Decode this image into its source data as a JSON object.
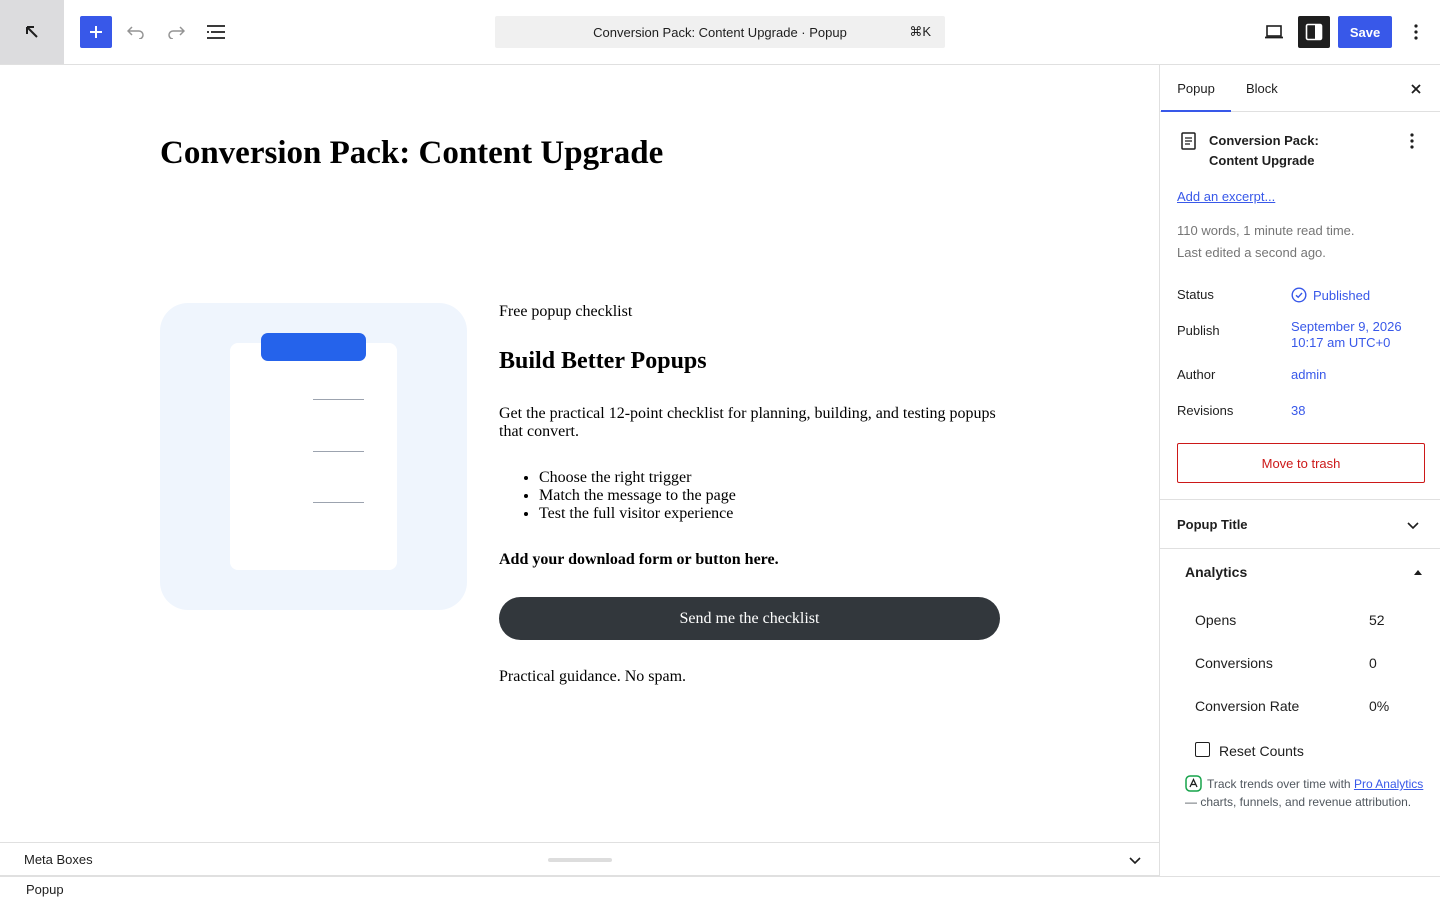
{
  "toolbar": {
    "command_title": "Conversion Pack: Content Upgrade · Popup",
    "command_shortcut": "⌘K",
    "save_label": "Save"
  },
  "icons": {
    "back": "arrow-up-left-icon",
    "add": "plus-icon",
    "undo": "undo-icon",
    "redo": "redo-icon",
    "outline": "list-view-icon",
    "preview": "laptop-icon",
    "sidebar": "sidebar-icon",
    "more": "vertical-ellipsis-icon"
  },
  "canvas": {
    "title": "Conversion Pack: Content Upgrade",
    "eyebrow": "Free popup checklist",
    "headline": "Build Better Popups",
    "description": "Get the practical 12-point checklist for planning, building, and testing popups that convert.",
    "bullets": [
      "Choose the right trigger",
      "Match the message to the page",
      "Test the full visitor experience"
    ],
    "form_note": "Add your download form or button here.",
    "cta_label": "Send me the checklist",
    "footnote": "Practical guidance. No spam."
  },
  "meta_boxes": {
    "label": "Meta Boxes"
  },
  "footer": {
    "breadcrumb": "Popup"
  },
  "sidebar": {
    "tabs": [
      "Popup",
      "Block"
    ],
    "doc_title": "Conversion Pack: Content Upgrade",
    "excerpt_link": "Add an excerpt...",
    "word_count": "110 words, 1 minute read time.",
    "last_edited": "Last edited a second ago.",
    "status": {
      "label": "Status",
      "value": "Published"
    },
    "publish": {
      "label": "Publish",
      "value_line1": "September 9, 2026",
      "value_line2": "10:17 am UTC+0"
    },
    "author": {
      "label": "Author",
      "value": "admin"
    },
    "revisions": {
      "label": "Revisions",
      "value": "38"
    },
    "trash_label": "Move to trash",
    "popup_title_panel": "Popup Title",
    "analytics": {
      "title": "Analytics",
      "stats": [
        {
          "label": "Opens",
          "value": "52"
        },
        {
          "label": "Conversions",
          "value": "0"
        },
        {
          "label": "Conversion Rate",
          "value": "0%"
        }
      ],
      "reset_label": "Reset Counts",
      "promo_prefix": "Track trends over time with ",
      "promo_link": "Pro Analytics",
      "promo_suffix": " — charts, funnels, and revenue attribution."
    }
  },
  "colors": {
    "accent": "#3858e9",
    "danger": "#cc1818",
    "cta_bg": "#32373c",
    "card_bg": "#eff5fd",
    "clip_blue": "#2563eb"
  }
}
